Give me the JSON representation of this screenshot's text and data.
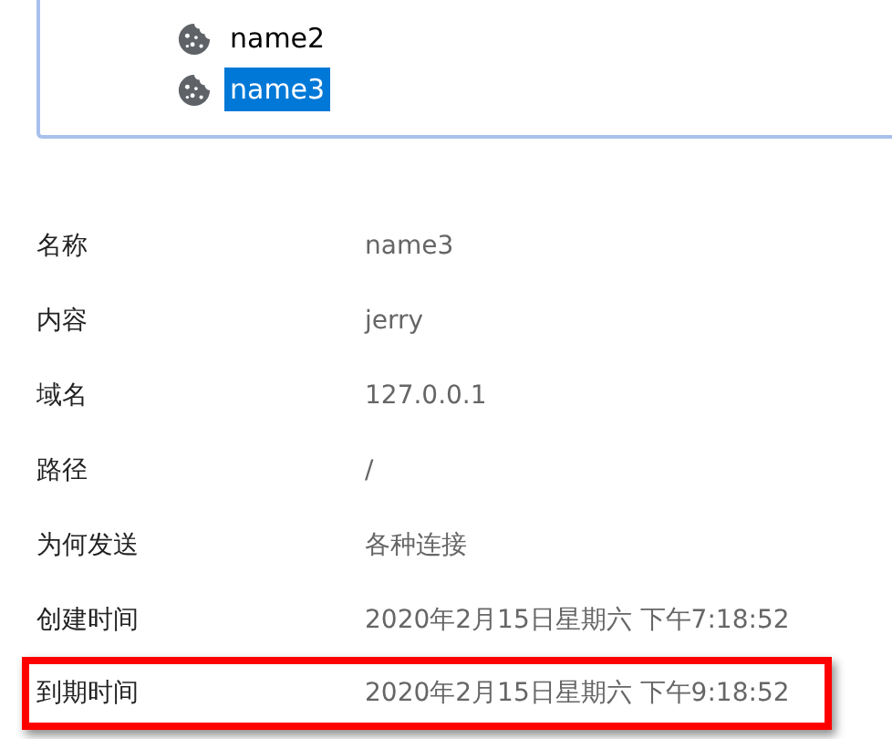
{
  "cookie_tree": {
    "items": [
      {
        "name": "name2",
        "selected": false
      },
      {
        "name": "name3",
        "selected": true
      }
    ]
  },
  "details": [
    {
      "label": "名称",
      "value": "name3",
      "highlighted": false
    },
    {
      "label": "内容",
      "value": "jerry",
      "highlighted": false
    },
    {
      "label": "域名",
      "value": "127.0.0.1",
      "highlighted": false
    },
    {
      "label": "路径",
      "value": "/",
      "highlighted": false
    },
    {
      "label": "为何发送",
      "value": "各种连接",
      "highlighted": false
    },
    {
      "label": "创建时间",
      "value": "2020年2月15日星期六 下午7:18:52",
      "highlighted": false
    },
    {
      "label": "到期时间",
      "value": "2020年2月15日星期六 下午9:18:52",
      "highlighted": true
    }
  ]
}
